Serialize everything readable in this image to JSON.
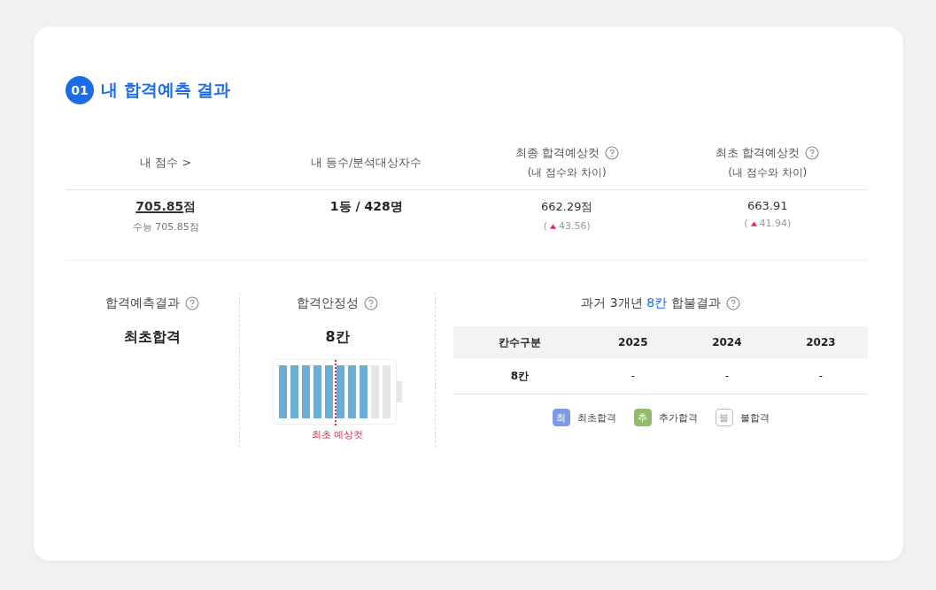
{
  "section": {
    "number": "01",
    "title": "내 합격예측 결과"
  },
  "summary": {
    "columns": [
      {
        "label": "내 점수 >",
        "help": false
      },
      {
        "label": "내 등수/분석대상자수",
        "help": false
      },
      {
        "label": "최종 합격예상컷",
        "help": true,
        "sub": "(내 점수와 차이)"
      },
      {
        "label": "최초 합격예상컷",
        "help": true,
        "sub": "(내 점수와 차이)"
      }
    ],
    "cells": [
      {
        "kind": "score",
        "value": "705.85",
        "unit": "점",
        "note": "수능 705.85점"
      },
      {
        "kind": "bold",
        "value": "1등 / 428명"
      },
      {
        "kind": "cut",
        "value": "662.29점",
        "open": "(",
        "diff": "43.56)"
      },
      {
        "kind": "cut",
        "value": "663.91",
        "open": "(",
        "diff": "41.94)"
      }
    ]
  },
  "result": {
    "label": "합격예측결과",
    "value": "최초합격"
  },
  "stability": {
    "label": "합격안정성",
    "value": "8칸",
    "level": 0.8,
    "cutoff": {
      "label": "최초 예상컷",
      "level": 0.5
    }
  },
  "history": {
    "title_before": "과거 3개년",
    "highlight": "8칸",
    "title_after": "합불결과",
    "columns": [
      "칸수구분",
      "2025",
      "2024",
      "2023"
    ],
    "rows": [
      [
        "8칸",
        "-",
        "-",
        "-"
      ]
    ],
    "legend": [
      {
        "mark": "최",
        "label": "최초합격",
        "color": "#7b9be6"
      },
      {
        "mark": "추",
        "label": "추가합격",
        "color": "#93b96f"
      },
      {
        "mark": "불",
        "label": "불합격",
        "color": "#ffffff"
      }
    ]
  }
}
